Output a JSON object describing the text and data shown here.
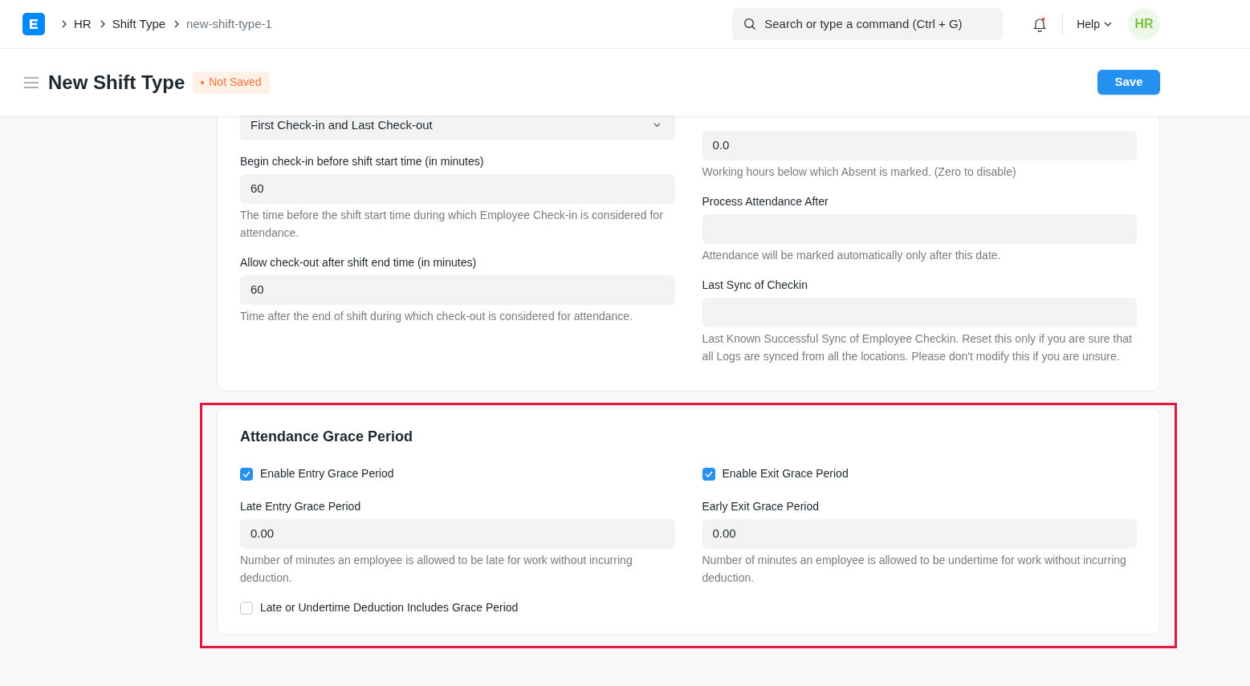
{
  "navbar": {
    "breadcrumbs": [
      {
        "label": "HR",
        "current": false
      },
      {
        "label": "Shift Type",
        "current": false
      },
      {
        "label": "new-shift-type-1",
        "current": true
      }
    ],
    "search": {
      "placeholder": "Search or type a command (Ctrl + G)"
    },
    "notifications": {
      "unread": true
    },
    "help": "Help",
    "avatar": "HR"
  },
  "page_head": {
    "title": "New Shift Type",
    "status": "Not Saved",
    "primary_action": "Save"
  },
  "sections": [
    {
      "highlighted": false,
      "columns": [
        [
          {
            "kind": "select",
            "value": "First Check-in and Last Check-out"
          },
          {
            "kind": "input",
            "label": "Begin check-in before shift start time (in minutes)",
            "value": "60",
            "description": "The time before the shift start time during which Employee Check-in is considered for attendance."
          },
          {
            "kind": "input",
            "label": "Allow check-out after shift end time (in minutes)",
            "value": "60",
            "description": "Time after the end of shift during which check-out is considered for attendance."
          }
        ],
        [
          {
            "kind": "input",
            "value": "0.0",
            "description": "Working hours below which Absent is marked. (Zero to disable)"
          },
          {
            "kind": "input",
            "label": "Process Attendance After",
            "description": "Attendance will be marked automatically only after this date."
          },
          {
            "kind": "input",
            "label": "Last Sync of Checkin",
            "description": "Last Known Successful Sync of Employee Checkin. Reset this only if you are sure that all Logs are synced from all the locations. Please don't modify this if you are unsure."
          }
        ]
      ]
    },
    {
      "title": "Attendance Grace Period",
      "highlighted": true,
      "columns": [
        [
          {
            "kind": "checkbox",
            "label": "Enable Entry Grace Period",
            "checked": true
          },
          {
            "kind": "input",
            "label": "Late Entry Grace Period",
            "value": "0.00",
            "description": "Number of minutes an employee is allowed to be late for work without incurring deduction."
          },
          {
            "kind": "checkbox",
            "label": "Late or Undertime Deduction Includes Grace Period",
            "checked": false
          }
        ],
        [
          {
            "kind": "checkbox",
            "label": "Enable Exit Grace Period",
            "checked": true
          },
          {
            "kind": "input",
            "label": "Early Exit Grace Period",
            "value": "0.00",
            "description": "Number of minutes an employee is allowed to be undertime for work without incurring deduction."
          }
        ]
      ]
    }
  ]
}
